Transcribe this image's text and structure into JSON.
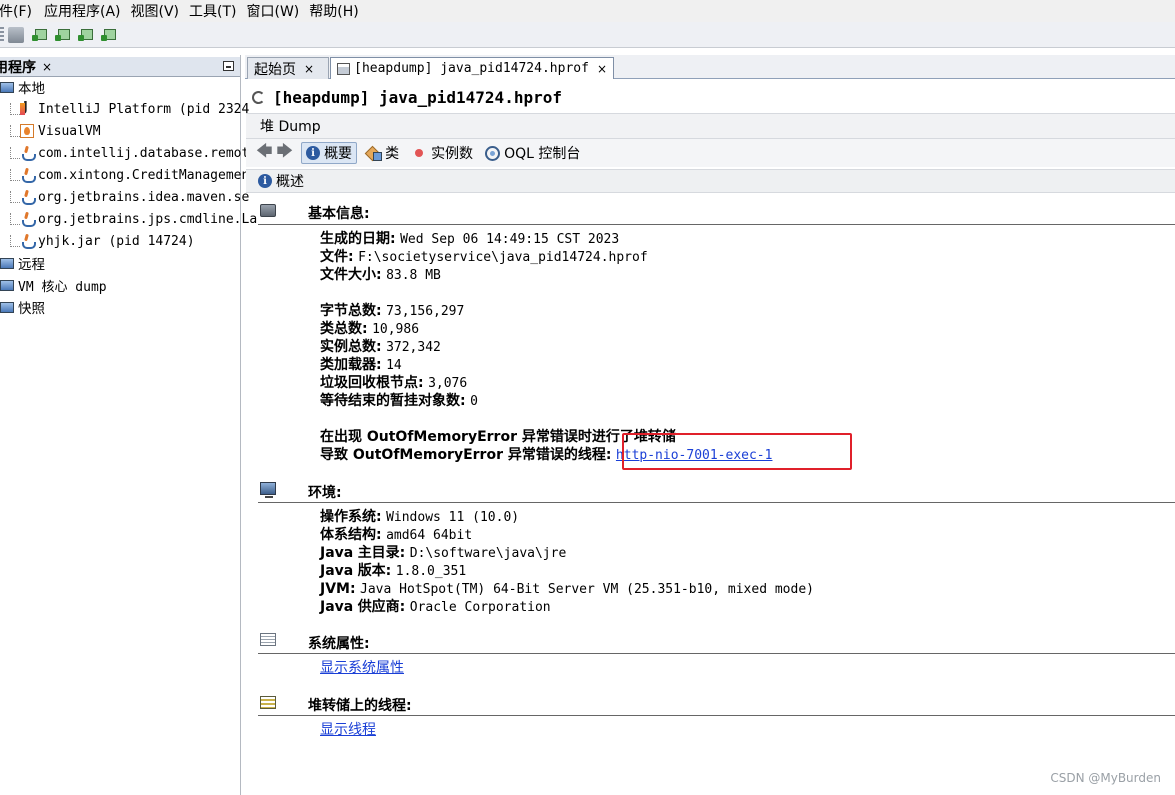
{
  "menu": [
    "件(F)",
    "应用程序(A)",
    "视图(V)",
    "工具(T)",
    "窗口(W)",
    "帮助(H)"
  ],
  "left_panel": {
    "title": "用程序",
    "close": "×",
    "tree": [
      {
        "label": "本地",
        "icon": "computer-icon"
      },
      {
        "label": "IntelliJ Platform (pid 2324",
        "icon": "intellij-icon"
      },
      {
        "label": "VisualVM",
        "icon": "visualvm-icon"
      },
      {
        "label": "com.intellij.database.remote",
        "icon": "java-icon"
      },
      {
        "label": "com.xintong.CreditManagement",
        "icon": "java-icon"
      },
      {
        "label": "org.jetbrains.idea.maven.se",
        "icon": "java-icon"
      },
      {
        "label": "org.jetbrains.jps.cmdline.La",
        "icon": "java-icon"
      },
      {
        "label": "yhjk.jar (pid 14724)",
        "icon": "java-icon"
      },
      {
        "label": "远程",
        "icon": "remote-icon"
      },
      {
        "label": "VM 核心 dump",
        "icon": "core-dump-icon"
      },
      {
        "label": "快照",
        "icon": "snapshot-icon"
      }
    ]
  },
  "tabs": [
    {
      "label": "起始页",
      "close": "×"
    },
    {
      "label": "[heapdump] java_pid14724.hprof",
      "close": "×"
    }
  ],
  "doc": {
    "title": "[heapdump] java_pid14724.hprof",
    "subtitle": "堆 Dump",
    "nav": {
      "summary": "概要",
      "classes": "类",
      "instances": "实例数",
      "oql": "OQL 控制台"
    },
    "section": "概述"
  },
  "basic": {
    "title": "基本信息:",
    "date_label": "生成的日期:",
    "date": "Wed Sep 06 14:49:15 CST 2023",
    "file_label": "文件:",
    "file": "F:\\societyservice\\java_pid14724.hprof",
    "size_label": "文件大小:",
    "size": "83.8 MB",
    "bytes_label": "字节总数:",
    "bytes": "73,156,297",
    "classes_label": "类总数:",
    "classes": "10,986",
    "instances_label": "实例总数:",
    "instances": "372,342",
    "loaders_label": "类加载器:",
    "loaders": "14",
    "gcroots_label": "垃圾回收根节点:",
    "gcroots": "3,076",
    "pending_label": "等待结束的暂挂对象数:",
    "pending": "0",
    "oom_line1": "在出现 OutOfMemoryError 异常错误时进行了堆转储",
    "oom_line2_label": "导致 OutOfMemoryError 异常错误的线程:",
    "oom_thread": "http-nio-7001-exec-1"
  },
  "env": {
    "title": "环境:",
    "os_label": "操作系统:",
    "os": "Windows 11 (10.0)",
    "arch_label": "体系结构:",
    "arch": "amd64 64bit",
    "home_label": "主目录:",
    "home": "D:\\software\\java\\jre",
    "ver_label": "版本:",
    "ver": "1.8.0_351",
    "jvm_label": "JVM:",
    "jvm": "Java HotSpot(TM) 64-Bit Server VM (25.351-b10, mixed mode)",
    "vendor_label": "供应商:",
    "vendor": "Oracle Corporation",
    "java_word": "Java"
  },
  "props": {
    "title": "系统属性:",
    "link": "显示系统属性"
  },
  "threads": {
    "title": "堆转储上的线程:",
    "link": "显示线程"
  },
  "watermark": "CSDN @MyBurden"
}
